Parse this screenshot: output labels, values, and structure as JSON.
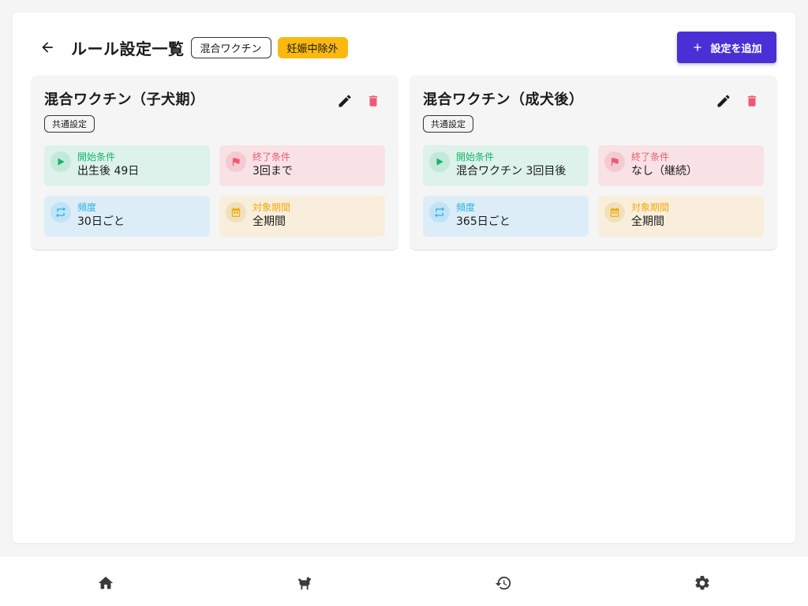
{
  "header": {
    "title": "ルール設定一覧",
    "chips": [
      "混合ワクチン",
      "妊娠中除外"
    ],
    "add_label": "設定を追加"
  },
  "colors": {
    "accent": "#4a2fd6",
    "amber": "#f9b90f",
    "start_green": "#16b56e",
    "end_red": "#ee5a73",
    "freq_blue": "#2db2e2",
    "period_yellow": "#f2ab0c"
  },
  "cards": [
    {
      "title": "混合ワクチン（子犬期）",
      "chip": "共通設定",
      "start": {
        "label": "開始条件",
        "value": "出生後 49日"
      },
      "end": {
        "label": "終了条件",
        "value": "3回まで"
      },
      "freq": {
        "label": "頻度",
        "value": "30日ごと"
      },
      "period": {
        "label": "対象期間",
        "value": "全期間"
      }
    },
    {
      "title": "混合ワクチン（成犬後）",
      "chip": "共通設定",
      "start": {
        "label": "開始条件",
        "value": "混合ワクチン 3回目後"
      },
      "end": {
        "label": "終了条件",
        "value": "なし（継続）"
      },
      "freq": {
        "label": "頻度",
        "value": "365日ごと"
      },
      "period": {
        "label": "対象期間",
        "value": "全期間"
      }
    }
  ],
  "icons": {
    "back": "arrow-left-icon",
    "add": "plus-icon",
    "edit": "pencil-icon",
    "delete": "trash-icon",
    "start": "play-icon",
    "end": "flag-icon",
    "freq": "repeat-icon",
    "period": "calendar-icon"
  },
  "bottom_nav": [
    "home-icon",
    "dog-icon",
    "history-icon",
    "gear-icon"
  ]
}
